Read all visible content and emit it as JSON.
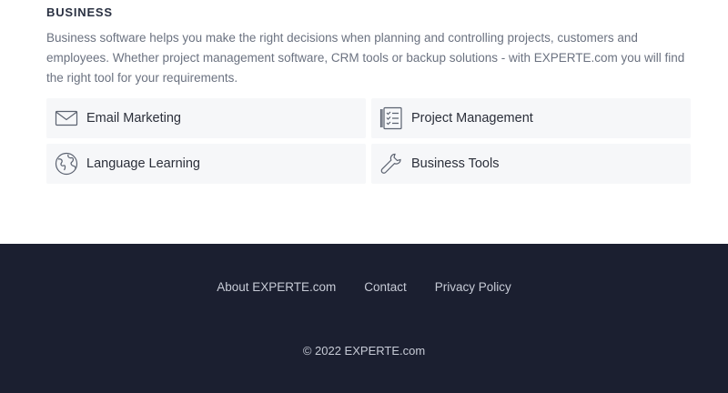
{
  "business": {
    "heading": "BUSINESS",
    "description": "Business software helps you make the right decisions when planning and controlling projects, customers and employees. Whether project management software, CRM tools or backup solutions - with EXPERTE.com you will find the right tool for your requirements.",
    "categories": [
      {
        "label": "Email Marketing",
        "icon": "envelope-icon"
      },
      {
        "label": "Project Management",
        "icon": "checklist-icon"
      },
      {
        "label": "Language Learning",
        "icon": "globe-icon"
      },
      {
        "label": "Business Tools",
        "icon": "wrench-icon"
      }
    ]
  },
  "footer": {
    "links": [
      "About EXPERTE.com",
      "Contact",
      "Privacy Policy"
    ],
    "copyright": "© 2022 EXPERTE.com",
    "background": "#1b1f30"
  }
}
